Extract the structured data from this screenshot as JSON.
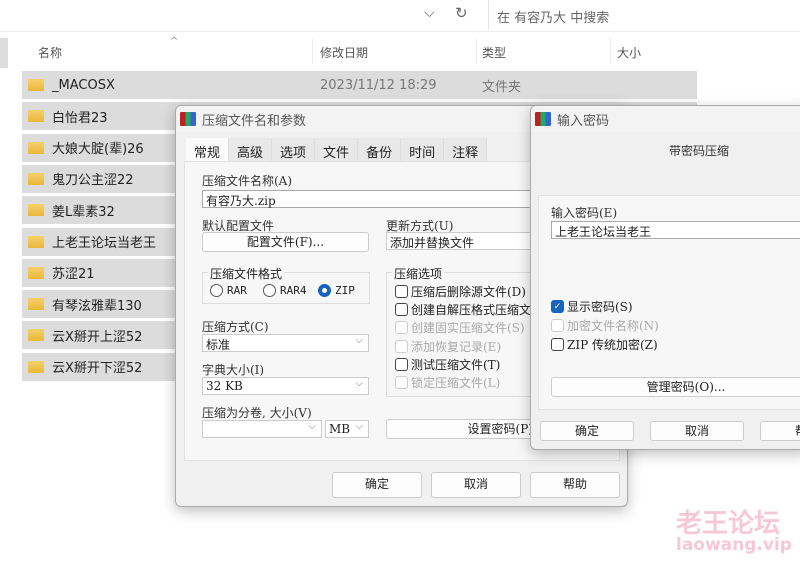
{
  "explorer": {
    "search_placeholder": "在 有容乃大 中搜索",
    "columns": {
      "name": "名称",
      "date": "修改日期",
      "type": "类型",
      "size": "大小"
    },
    "rows": [
      {
        "name": "_MACOSX",
        "date": "2023/11/12 18:29",
        "type": "文件夹"
      },
      {
        "name": "白怡君23"
      },
      {
        "name": "大娘大腚(辈)26"
      },
      {
        "name": "鬼刀公主涩22"
      },
      {
        "name": "姜L辈素32"
      },
      {
        "name": "上老王论坛当老王"
      },
      {
        "name": "苏涩21"
      },
      {
        "name": "有琴泫雅辈130"
      },
      {
        "name": "云X掰开上涩52"
      },
      {
        "name": "云X掰开下涩52"
      }
    ]
  },
  "archive_dialog": {
    "title": "压缩文件名和参数",
    "tabs": [
      "常规",
      "高级",
      "选项",
      "文件",
      "备份",
      "时间",
      "注释"
    ],
    "archive_name_label": "压缩文件名称(A)",
    "archive_name": "有容乃大.zip",
    "profile_label": "默认配置文件",
    "profile_button": "配置文件(F)...",
    "update_label": "更新方式(U)",
    "update_value": "添加并替换文件",
    "format_label": "压缩文件格式",
    "formats": [
      "RAR",
      "RAR4",
      "ZIP"
    ],
    "selected_format": "ZIP",
    "method_label": "压缩方式(C)",
    "method_value": "标准",
    "dict_label": "字典大小(I)",
    "dict_value": "32 KB",
    "split_label": "压缩为分卷, 大小(V)",
    "split_unit": "MB",
    "options_label": "压缩选项",
    "options": [
      {
        "label": "压缩后删除源文件(D)",
        "checked": false,
        "enabled": true
      },
      {
        "label": "创建自解压格式压缩文件(X)",
        "checked": false,
        "enabled": true
      },
      {
        "label": "创建固实压缩文件(S)",
        "checked": false,
        "enabled": false
      },
      {
        "label": "添加恢复记录(E)",
        "checked": false,
        "enabled": false
      },
      {
        "label": "测试压缩文件(T)",
        "checked": false,
        "enabled": true
      },
      {
        "label": "锁定压缩文件(L)",
        "checked": false,
        "enabled": false
      }
    ],
    "set_password": "设置密码(P)...",
    "ok": "确定",
    "cancel": "取消",
    "help": "帮助"
  },
  "password_dialog": {
    "title": "输入密码",
    "heading": "带密码压缩",
    "password_label": "输入密码(E)",
    "password": "上老王论坛当老王",
    "show_password": "显示密码(S)",
    "encrypt_names": "加密文件名称(N)",
    "zip_legacy": "ZIP 传统加密(Z)",
    "manage": "管理密码(O)...",
    "ok": "确定",
    "cancel": "取消",
    "help": "帮助"
  },
  "watermark": {
    "cn": "老王论坛",
    "en": "laowang.vip"
  }
}
